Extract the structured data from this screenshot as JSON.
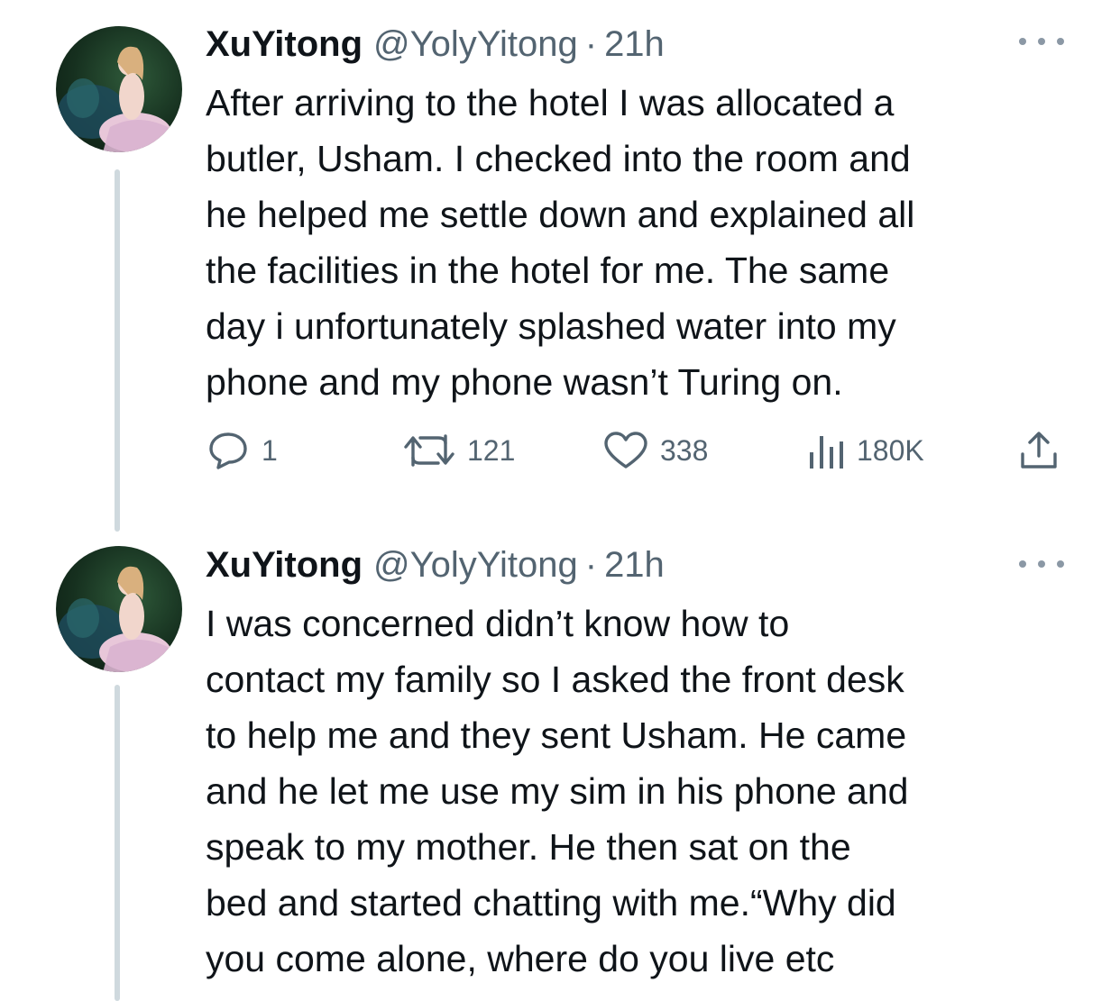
{
  "tweets": [
    {
      "author_name": "XuYitong",
      "handle": "@YolyYitong",
      "separator": "·",
      "time": "21h",
      "lines": [
        "After arriving to the hotel I was allocated a",
        "butler, Usham. I checked into the room and",
        "he helped me settle down and explained all",
        "the facilities in the hotel for me. The same",
        "day i unfortunately splashed water into my",
        "phone and my phone wasn’t Turing on."
      ],
      "stats": {
        "replies": "1",
        "retweets": "121",
        "likes": "338",
        "views": "180K"
      }
    },
    {
      "author_name": "XuYitong",
      "handle": "@YolyYitong",
      "separator": "·",
      "time": "21h",
      "lines": [
        "I was concerned didn’t know how to",
        "contact my family so I asked the front desk",
        "to help me and they sent Usham. He came",
        "and he let me use my sim in his phone and",
        "speak to my mother. He then sat on the",
        "bed and started chatting with me.“Why did",
        "you come alone, where do you live etc"
      ]
    }
  ],
  "icons": {
    "reply": "reply-icon",
    "retweet": "retweet-icon",
    "like": "heart-icon",
    "views": "views-icon",
    "share": "share-icon",
    "more": "more-icon"
  },
  "colors": {
    "text": "#0f1419",
    "secondary": "#536471",
    "thread_line": "#cfd9de"
  }
}
